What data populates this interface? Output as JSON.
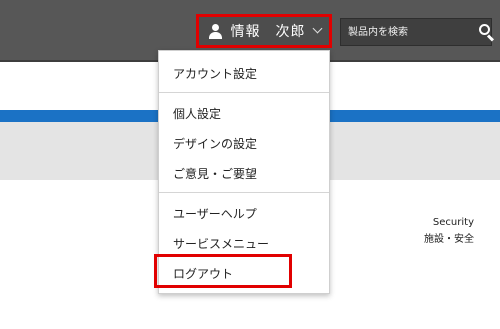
{
  "header": {
    "user_name": "情報　次郎",
    "search_placeholder": "製品内を検索",
    "search_icon": "search-icon",
    "user_icon": "user-icon",
    "chevron_icon": "chevron-down-icon"
  },
  "user_menu": {
    "items": [
      {
        "label": "アカウント設定"
      },
      {
        "label": "個人設定"
      },
      {
        "label": "デザインの設定"
      },
      {
        "label": "ご意見・ご要望"
      },
      {
        "label": "ユーザーヘルプ"
      },
      {
        "label": "サービスメニュー"
      },
      {
        "label": "ログアウト"
      }
    ]
  },
  "content": {
    "security_label": "Security",
    "security_sub": "施設・安全"
  },
  "colors": {
    "topbar": "#575757",
    "accent_blue": "#1b72c5",
    "highlight_red": "#e10000",
    "gray_band": "#e4e4e4"
  }
}
